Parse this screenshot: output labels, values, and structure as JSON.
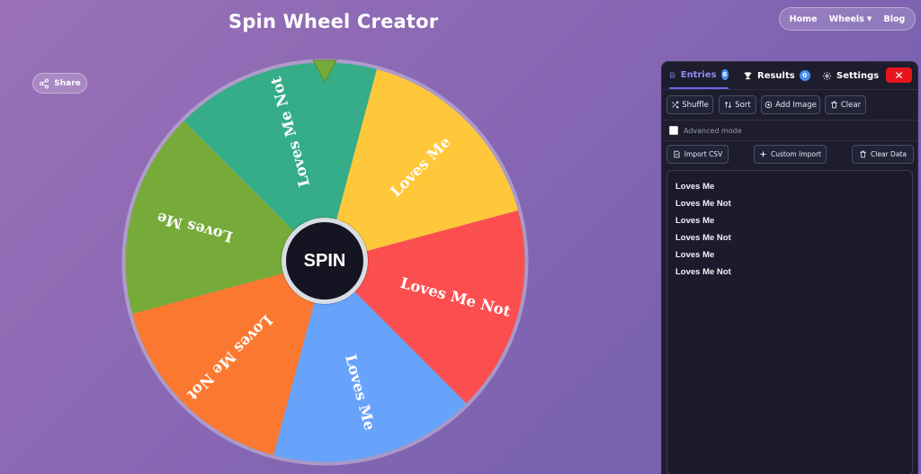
{
  "app": {
    "title": "Spin Wheel Creator"
  },
  "nav": {
    "items": [
      {
        "label": "Home"
      },
      {
        "label": "Wheels",
        "has_dropdown": true
      },
      {
        "label": "Blog"
      }
    ]
  },
  "share": {
    "label": "Share"
  },
  "wheel": {
    "spin_label": "SPIN",
    "segments": [
      {
        "label": "Loves Me",
        "color": "#76ab3a"
      },
      {
        "label": "Loves Me Not",
        "color": "#34ad88"
      },
      {
        "label": "Loves Me",
        "color": "#fec83a"
      },
      {
        "label": "Loves Me Not",
        "color": "#fb4f4f"
      },
      {
        "label": "Loves Me",
        "color": "#67a3fa"
      },
      {
        "label": "Loves Me Not",
        "color": "#fa782f"
      }
    ]
  },
  "panel": {
    "tabs": {
      "entries": {
        "label": "Entries",
        "count": "6"
      },
      "results": {
        "label": "Results",
        "count": "0"
      },
      "settings": {
        "label": "Settings"
      }
    },
    "close_label": "✕",
    "toolbar": {
      "shuffle": "Shuffle",
      "sort": "Sort",
      "add_image": "Add Image",
      "clear": "Clear"
    },
    "advanced_mode": "Advanced mode",
    "import": {
      "csv": "Import CSV",
      "custom": "Custom Import",
      "clear_data": "Clear Data"
    },
    "entries": [
      "Loves Me",
      "Loves Me Not",
      "Loves Me",
      "Loves Me Not",
      "Loves Me",
      "Loves Me Not"
    ]
  },
  "colors": {
    "accent": "#6c66e8",
    "close": "#e8141c",
    "panel_bg": "#1d1d2e",
    "pointer": "#76ab3a"
  }
}
